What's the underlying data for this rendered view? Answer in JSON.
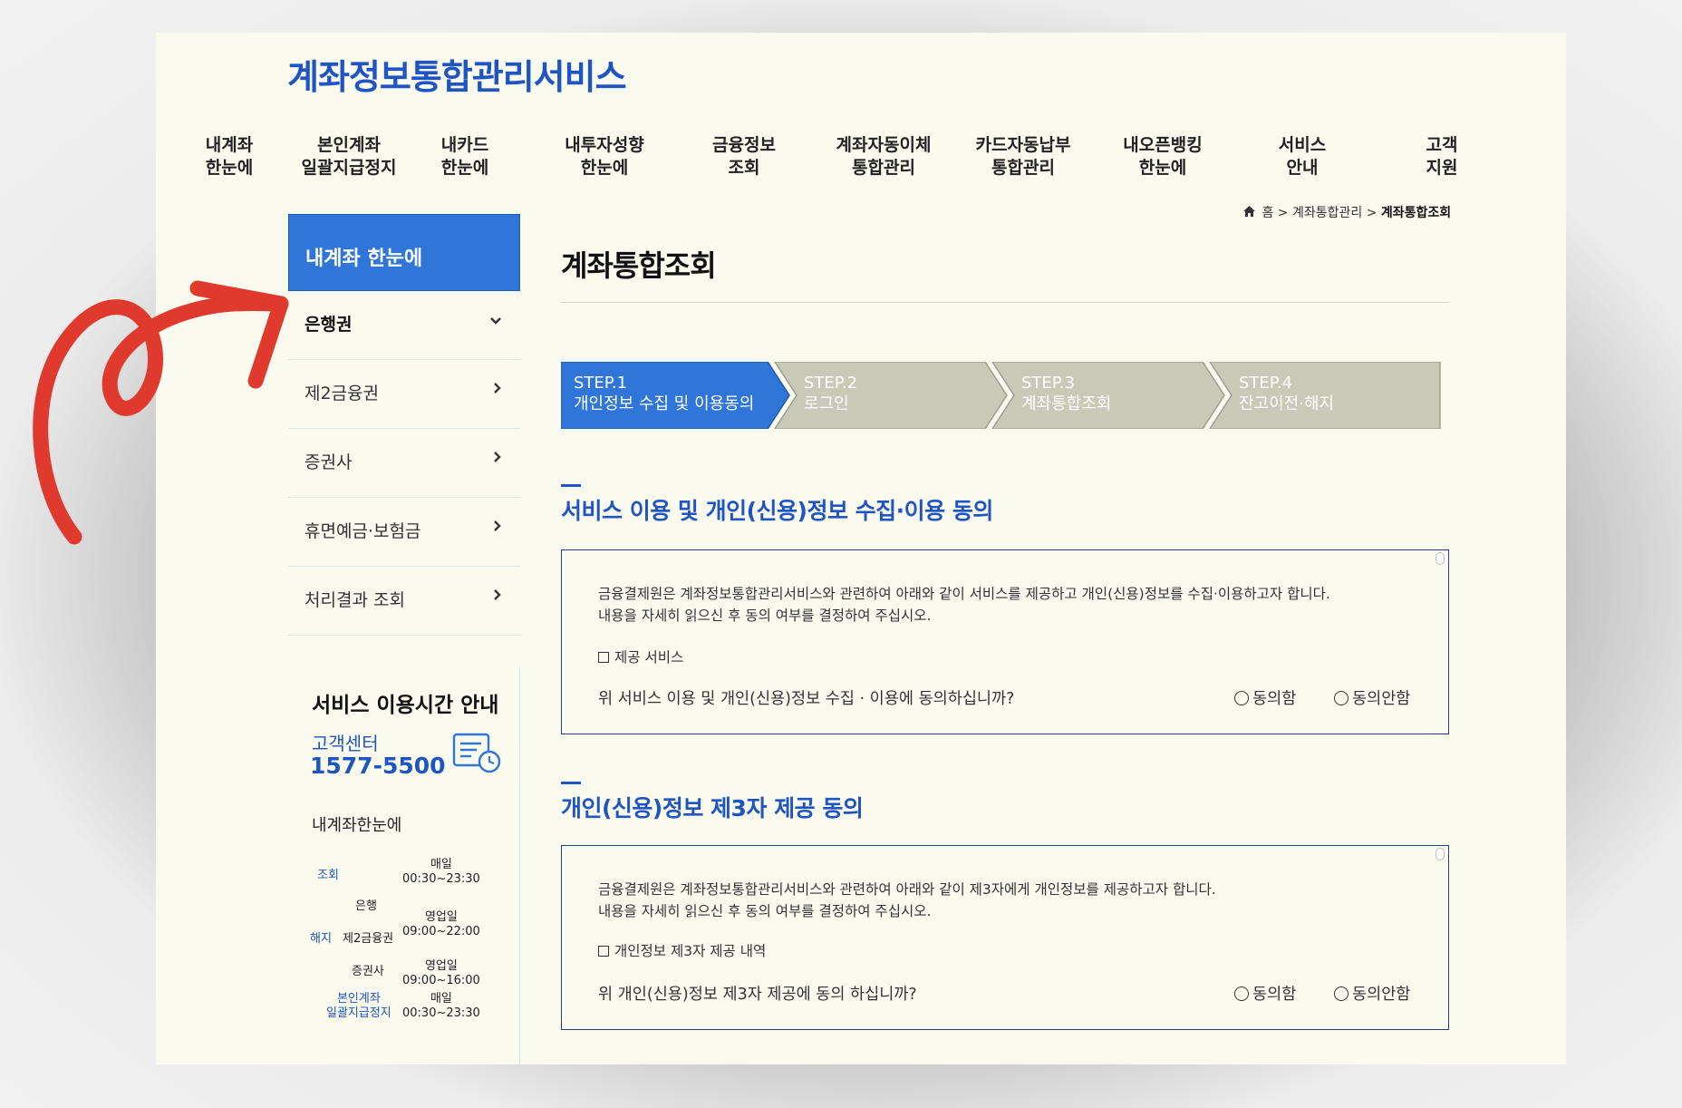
{
  "header": {
    "brand": "계좌정보통합관리서비스"
  },
  "gnb": [
    {
      "label": "내계좌\n한눈에"
    },
    {
      "label": "본인계좌\n일괄지급정지"
    },
    {
      "label": "내카드\n한눈에"
    },
    {
      "label": "내투자성향\n한눈에"
    },
    {
      "label": "금융정보\n조회"
    },
    {
      "label": "계좌자동이체\n통합관리"
    },
    {
      "label": "카드자동납부\n통합관리"
    },
    {
      "label": "내오픈뱅킹\n한눈에"
    },
    {
      "label": "서비스\n안내"
    },
    {
      "label": "고객\n지원"
    }
  ],
  "breadcrumb": {
    "home": "홈",
    "sep": ">",
    "level1": "계좌통합관리",
    "current": "계좌통합조회"
  },
  "sidebar": {
    "title": "내계좌 한눈에",
    "items": [
      {
        "label": "은행권",
        "icon": "chevron-down-icon"
      },
      {
        "label": "제2금융권",
        "icon": "chevron-right-icon"
      },
      {
        "label": "증권사",
        "icon": "chevron-right-icon"
      },
      {
        "label": "휴면예금·보험금",
        "icon": "chevron-right-icon"
      },
      {
        "label": "처리결과 조회",
        "icon": "chevron-right-icon"
      }
    ],
    "service_hours": {
      "title": "서비스 이용시간 안내",
      "center_label": "고객센터",
      "phone": "1577-5500",
      "sub_title": "내계좌한눈에",
      "rows": {
        "inquiry": "조회",
        "daily1": "매일\n00:30~23:30",
        "bank": "은행",
        "terminate": "해지",
        "second_fin": "제2금융권",
        "business1": "영업일\n09:00~22:00",
        "securities": "증권사",
        "business2": "영업일\n09:00~16:00",
        "bulk_stop": "본인계좌\n일괄지급정지",
        "daily2": "매일\n00:30~23:30"
      }
    }
  },
  "main": {
    "title": "계좌통합조회",
    "steps": [
      {
        "label": "STEP.1\n개인정보 수집 및 이용동의",
        "active": true
      },
      {
        "label": "STEP.2\n로그인",
        "active": false
      },
      {
        "label": "STEP.3\n계좌통합조회",
        "active": false
      },
      {
        "label": "STEP.4\n잔고이전·해지",
        "active": false
      }
    ],
    "sections": [
      {
        "title": "서비스 이용 및 개인(신용)정보 수집·이용 동의",
        "text": "금융결제원은 계좌정보통합관리서비스와 관련하여 아래와 같이 서비스를 제공하고 개인(신용)정보를 수집·이용하고자 합니다.\n내용을 자세히 읽으신 후 동의 여부를 결정하여 주십시오.",
        "sub": "제공 서비스",
        "question": "위 서비스 이용 및 개인(신용)정보 수집 · 이용에 동의하십니까?",
        "agree": "동의함",
        "disagree": "동의안함"
      },
      {
        "title": "개인(신용)정보 제3자 제공 동의",
        "text": "금융결제원은 계좌정보통합관리서비스와 관련하여 아래와 같이 제3자에게 개인정보를 제공하고자 합니다.\n내용을 자세히 읽으신 후 동의 여부를 결정하여 주십시오.",
        "sub": "개인정보 제3자 제공 내역",
        "question": "위 개인(신용)정보 제3자 제공에 동의 하십니까?",
        "agree": "동의함",
        "disagree": "동의안함"
      }
    ]
  },
  "colors": {
    "brand": "#1f55c2",
    "active_step": "#2f76d8",
    "inactive_step": "#c9c9b8",
    "annotation_arrow": "#e03a2e",
    "page_bg": "#fbfaee"
  }
}
